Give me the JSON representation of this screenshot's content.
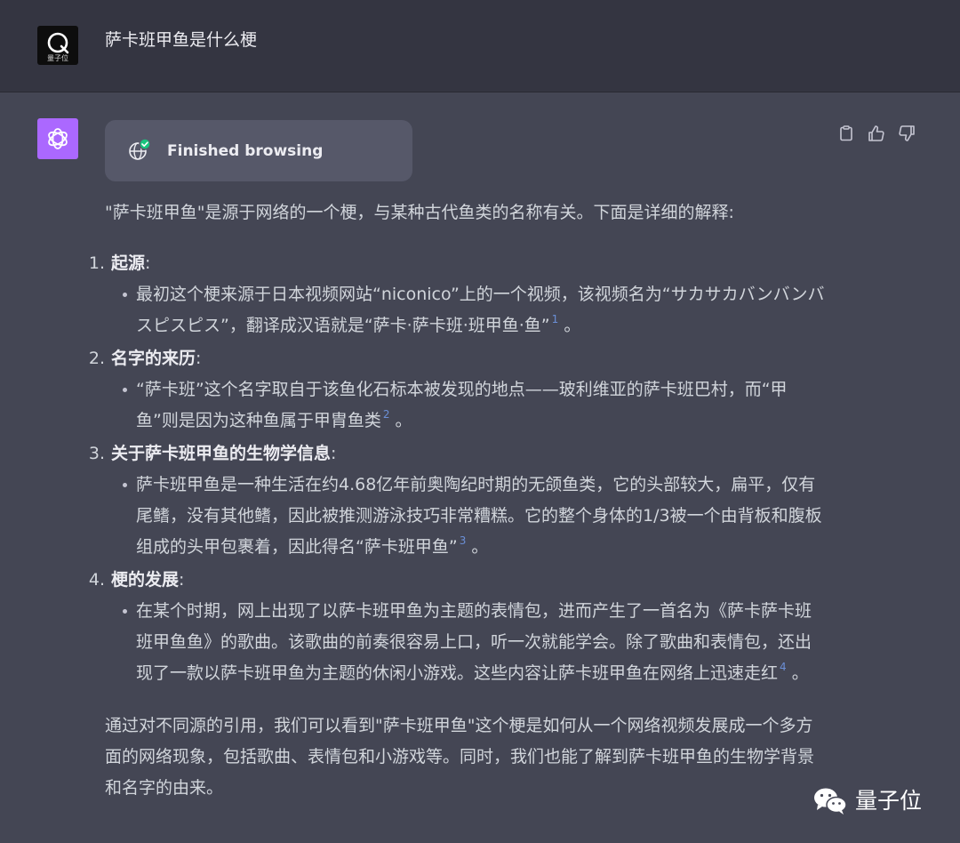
{
  "user": {
    "avatar_logo_text": "量子位",
    "message": "萨卡班甲鱼是什么梗"
  },
  "assistant": {
    "browse_status": "Finished browsing",
    "intro": "\"萨卡班甲鱼\"是源于网络的一个梗，与某种古代鱼类的名称有关。下面是详细的解释:",
    "sections": [
      {
        "number": "1.",
        "title": "起源",
        "colon": ":",
        "bullets": [
          {
            "text": "最初这个梗来源于日本视频网站“niconico”上的一个视频，该视频名为“サカサカバンバンバスピスピス”，翻译成汉语就是“萨卡·萨卡班·班甲鱼·鱼”",
            "cite": "1",
            "tail": "。"
          }
        ]
      },
      {
        "number": "2.",
        "title": "名字的来历",
        "colon": ":",
        "bullets": [
          {
            "text": "“萨卡班”这个名字取自于该鱼化石标本被发现的地点——玻利维亚的萨卡班巴村，而“甲鱼”则是因为这种鱼属于甲胄鱼类",
            "cite": "2",
            "tail": "。"
          }
        ]
      },
      {
        "number": "3.",
        "title": "关于萨卡班甲鱼的生物学信息",
        "colon": ":",
        "bullets": [
          {
            "text": "萨卡班甲鱼是一种生活在约4.68亿年前奥陶纪时期的无颌鱼类，它的头部较大，扁平，仅有尾鳍，没有其他鳍，因此被推测游泳技巧非常糟糕。它的整个身体的1/3被一个由背板和腹板组成的头甲包裹着，因此得名“萨卡班甲鱼”",
            "cite": "3",
            "tail": "。"
          }
        ]
      },
      {
        "number": "4.",
        "title": "梗的发展",
        "colon": ":",
        "bullets": [
          {
            "text": "在某个时期，网上出现了以萨卡班甲鱼为主题的表情包，进而产生了一首名为《萨卡萨卡班班甲鱼鱼》的歌曲。该歌曲的前奏很容易上口，听一次就能学会。除了歌曲和表情包，还出现了一款以萨卡班甲鱼为主题的休闲小游戏。这些内容让萨卡班甲鱼在网络上迅速走红",
            "cite": "4",
            "tail": "。"
          }
        ]
      }
    ],
    "conclusion": "通过对不同源的引用，我们可以看到\"萨卡班甲鱼\"这个梗是如何从一个网络视频发展成一个多方面的网络现象，包括歌曲、表情包和小游戏等。同时，我们也能了解到萨卡班甲鱼的生物学背景和名字的由来。"
  },
  "actions": {
    "icons": [
      "clipboard-icon",
      "thumbs-up-icon",
      "thumbs-down-icon"
    ]
  },
  "watermark": {
    "text": "量子位"
  },
  "colors": {
    "user_bg": "#343541",
    "assistant_bg": "#444654",
    "avatar_purple": "#ab68ff",
    "browse_card": "#565869",
    "check_green": "#19c37d",
    "citation_blue": "#6b8fd6"
  }
}
